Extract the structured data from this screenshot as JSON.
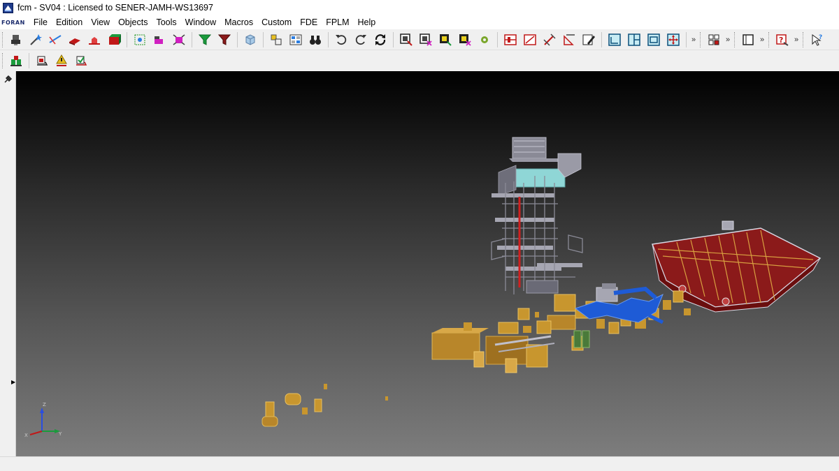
{
  "window": {
    "title": "fcm - SV04 : Licensed to SENER-JAMH-WS13697"
  },
  "menu": {
    "logo": "FORAN",
    "items": [
      "File",
      "Edition",
      "View",
      "Objects",
      "Tools",
      "Window",
      "Macros",
      "Custom",
      "FDE",
      "FPLM",
      "Help"
    ]
  },
  "toolbar": {
    "overflow": "»"
  },
  "viewport": {
    "axis": {
      "x": "X",
      "y": "Y",
      "z": "Z"
    }
  },
  "colors": {
    "hull": "#8b1a1a",
    "equipment": "#c8962e",
    "piping": "#1e5bd6",
    "superstructure": "#9a9aa6",
    "glass": "#8fd6d6"
  }
}
